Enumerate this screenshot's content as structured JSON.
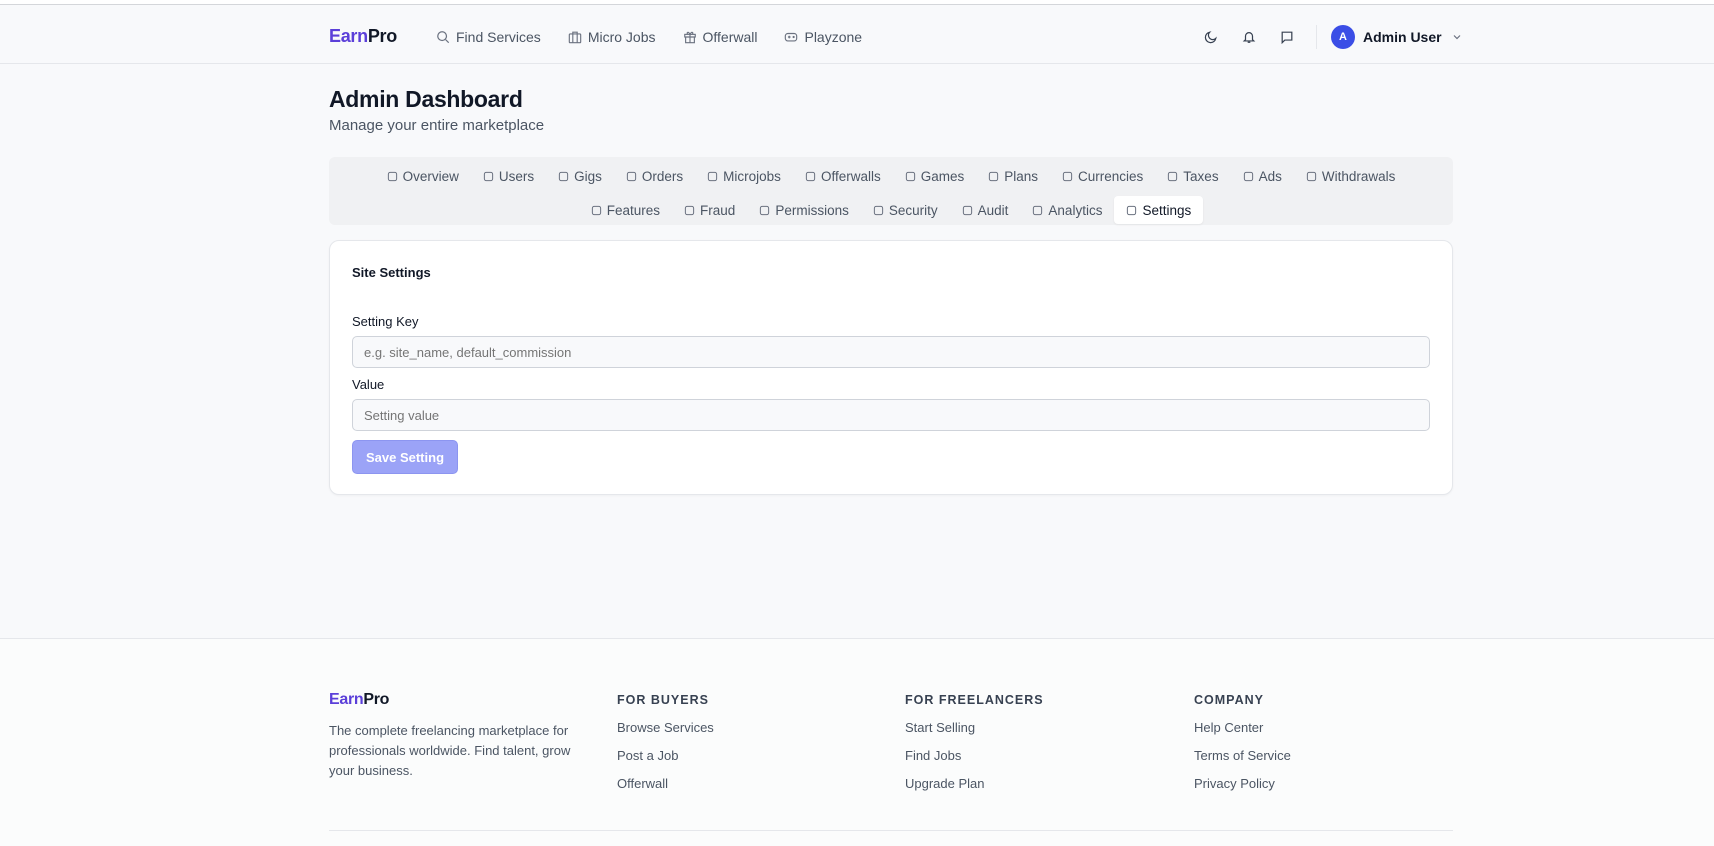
{
  "brand": {
    "part1": "Earn",
    "part2": "Pro"
  },
  "nav": {
    "links": [
      {
        "label": "Find Services",
        "icon": "search-icon"
      },
      {
        "label": "Micro Jobs",
        "icon": "briefcase-icon"
      },
      {
        "label": "Offerwall",
        "icon": "gift-icon"
      },
      {
        "label": "Playzone",
        "icon": "gamepad-icon"
      }
    ],
    "user": {
      "initial": "A",
      "name": "Admin User"
    }
  },
  "header": {
    "title": "Admin Dashboard",
    "subtitle": "Manage your entire marketplace"
  },
  "tabs": [
    {
      "label": "Overview"
    },
    {
      "label": "Users"
    },
    {
      "label": "Gigs"
    },
    {
      "label": "Orders"
    },
    {
      "label": "Microjobs"
    },
    {
      "label": "Offerwalls"
    },
    {
      "label": "Games"
    },
    {
      "label": "Plans"
    },
    {
      "label": "Currencies"
    },
    {
      "label": "Taxes"
    },
    {
      "label": "Ads"
    },
    {
      "label": "Withdrawals"
    },
    {
      "label": "Features"
    },
    {
      "label": "Fraud"
    },
    {
      "label": "Permissions"
    },
    {
      "label": "Security"
    },
    {
      "label": "Audit"
    },
    {
      "label": "Analytics"
    },
    {
      "label": "Settings",
      "active": true
    }
  ],
  "settings": {
    "title": "Site Settings",
    "key_label": "Setting Key",
    "key_placeholder": "e.g. site_name, default_commission",
    "value_label": "Value",
    "value_placeholder": "Setting value",
    "save_label": "Save Setting"
  },
  "footer": {
    "description": "The complete freelancing marketplace for professionals worldwide. Find talent, grow your business.",
    "columns": [
      {
        "title": "FOR BUYERS",
        "links": [
          "Browse Services",
          "Post a Job",
          "Offerwall"
        ]
      },
      {
        "title": "FOR FREELANCERS",
        "links": [
          "Start Selling",
          "Find Jobs",
          "Upgrade Plan"
        ]
      },
      {
        "title": "COMPANY",
        "links": [
          "Help Center",
          "Terms of Service",
          "Privacy Policy"
        ]
      }
    ]
  }
}
